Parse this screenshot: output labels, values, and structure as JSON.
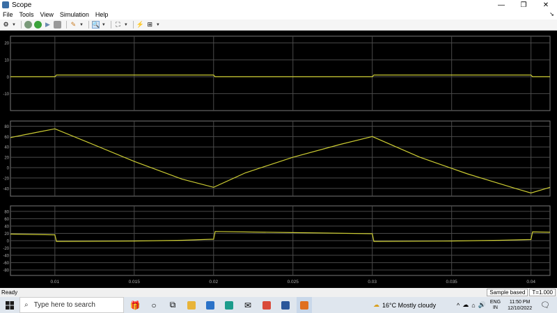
{
  "window": {
    "title": "Scope",
    "min": "—",
    "max": "❐",
    "close": "✕"
  },
  "menu": {
    "items": [
      "File",
      "Tools",
      "View",
      "Simulation",
      "Help"
    ]
  },
  "status": {
    "left": "Ready",
    "mode": "Sample based",
    "time": "T=1.000"
  },
  "taskbar": {
    "search_placeholder": "Type here to search",
    "weather": "16°C  Mostly cloudy",
    "lang_top": "ENG",
    "lang_bottom": "IN",
    "time": "11:50 PM",
    "date": "12/10/2022"
  },
  "colors": {
    "trace": "#cccc33",
    "grid": "#4a4a4a",
    "bg": "#000000",
    "axis_text": "#b0b0b0"
  },
  "chart_data": [
    {
      "type": "line",
      "x": [
        0.0072,
        0.01,
        0.0101,
        0.02,
        0.0201,
        0.03,
        0.0301,
        0.04,
        0.0401,
        0.0412
      ],
      "series": [
        {
          "values": [
            0,
            0,
            1,
            1,
            0,
            0,
            1,
            1,
            0,
            0
          ]
        }
      ],
      "yticks": [
        -10,
        0,
        10,
        20
      ],
      "ylim": [
        -20,
        24
      ],
      "xlim": [
        0.0072,
        0.0412
      ]
    },
    {
      "type": "line",
      "x": [
        0.0072,
        0.008,
        0.009,
        0.01,
        0.012,
        0.015,
        0.018,
        0.02,
        0.022,
        0.025,
        0.028,
        0.03,
        0.033,
        0.036,
        0.039,
        0.04,
        0.0412
      ],
      "series": [
        {
          "values": [
            58,
            63,
            69,
            75,
            50,
            12,
            -22,
            -38,
            -10,
            20,
            45,
            60,
            20,
            -12,
            -40,
            -49,
            -38
          ]
        }
      ],
      "yticks": [
        -40,
        -20,
        0,
        20,
        40,
        60,
        80
      ],
      "ylim": [
        -55,
        90
      ],
      "xlim": [
        0.0072,
        0.0412
      ]
    },
    {
      "type": "line",
      "x": [
        0.0072,
        0.01,
        0.0101,
        0.015,
        0.018,
        0.02,
        0.0201,
        0.025,
        0.03,
        0.0301,
        0.035,
        0.038,
        0.04,
        0.0401,
        0.0412
      ],
      "series": [
        {
          "values": [
            18,
            16,
            -2,
            -1,
            1,
            4,
            25,
            22,
            19,
            -2,
            -1,
            1,
            3,
            24,
            23
          ]
        }
      ],
      "yticks": [
        -80,
        -60,
        -40,
        -20,
        0,
        20,
        40,
        60,
        80
      ],
      "ylim": [
        -95,
        95
      ],
      "xlim": [
        0.0072,
        0.0412
      ],
      "xticks": [
        "0.01",
        "0.015",
        "0.02",
        "0.025",
        "0.03",
        "0.035",
        "0.04"
      ]
    }
  ]
}
